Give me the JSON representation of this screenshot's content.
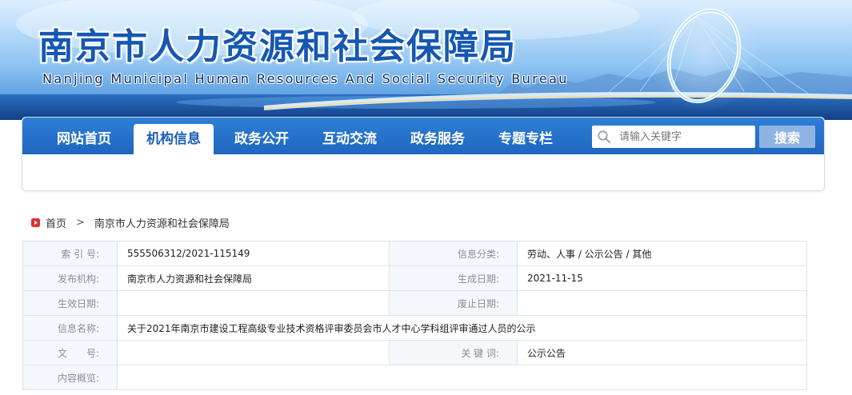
{
  "banner": {
    "title_cn": "南京市人力资源和社会保障局",
    "title_en": "Nanjing Municipal Human Resources And Social Security Bureau"
  },
  "nav": {
    "items": [
      {
        "label": "网站首页",
        "active": false
      },
      {
        "label": "机构信息",
        "active": true
      },
      {
        "label": "政务公开",
        "active": false
      },
      {
        "label": "互动交流",
        "active": false
      },
      {
        "label": "政务服务",
        "active": false
      },
      {
        "label": "专题专栏",
        "active": false
      }
    ],
    "search": {
      "placeholder": "请输入关键字",
      "button_label": "搜索",
      "icon": "search-icon"
    }
  },
  "breadcrumb": {
    "icon": "home-icon",
    "home_label": "首页",
    "separator": ">",
    "current": "南京市人力资源和社会保障局"
  },
  "info": {
    "index_label": "索 引 号:",
    "index_value": "555506312/2021-115149",
    "category_label": "信息分类:",
    "category_value": "劳动、人事 / 公示公告 / 其他",
    "publisher_label": "发布机构:",
    "publisher_value": "南京市人力资源和社会保障局",
    "created_label": "生成日期:",
    "created_value": "2021-11-15",
    "effective_label": "生效日期:",
    "effective_value": "",
    "expired_label": "废止日期:",
    "expired_value": "",
    "name_label": "信息名称:",
    "name_value": "关于2021年南京市建设工程高级专业技术资格评审委员会市人才中心学科组评审通过人员的公示",
    "docno_label": "文　　号:",
    "docno_value": "",
    "keywords_label": "关 键 词:",
    "keywords_value": "公示公告",
    "summary_label": "内容概览:",
    "summary_value": ""
  },
  "colors": {
    "nav_blue": "#1f66bf",
    "title_blue": "#1558b4",
    "search_button": "#8fb3e2",
    "home_icon_red": "#e0302f"
  }
}
